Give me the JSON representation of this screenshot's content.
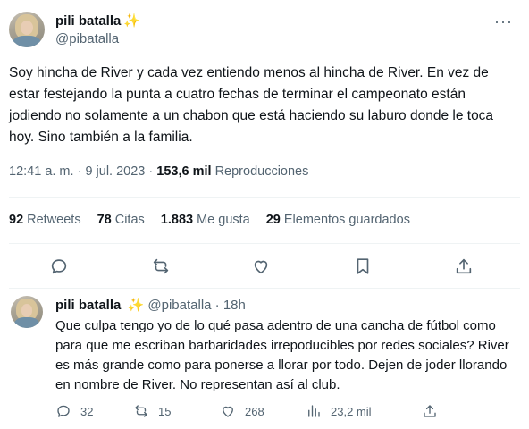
{
  "main_tweet": {
    "author_name": "pili batalla",
    "author_handle": "@pibatalla",
    "badge_emoji": "✨",
    "text": "Soy hincha de River y cada vez entiendo menos al hincha de River. En vez de estar festejando la punta a cuatro fechas de terminar el campeonato están jodiendo no solamente a un chabon que está haciendo su laburo donde le toca hoy. Sino también a la familia.",
    "time": "12:41 a. m.",
    "separator": "·",
    "date": "9 jul. 2023",
    "views_count": "153,6 mil",
    "views_label": "Reproducciones",
    "more_label": "···",
    "stats": {
      "retweets_count": "92",
      "retweets_label": "Retweets",
      "quotes_count": "78",
      "quotes_label": "Citas",
      "likes_count": "1.883",
      "likes_label": "Me gusta",
      "bookmarks_count": "29",
      "bookmarks_label": "Elementos guardados"
    },
    "action_icons": [
      "reply-icon",
      "retweet-icon",
      "like-icon",
      "bookmark-icon",
      "share-icon"
    ]
  },
  "reply_tweet": {
    "author_name": "pili batalla",
    "badge_emoji": "✨",
    "author_handle": "@pibatalla",
    "separator": "·",
    "time_ago": "18h",
    "text": "Que culpa tengo yo de lo qué pasa adentro de una cancha de fútbol como para que me escriban barbaridades irrepoducibles por redes sociales? River es más grande como para ponerse a llorar por todo. Dejen de joder llorando en nombre de River. No representan así al club.",
    "replies": "32",
    "retweets": "15",
    "likes": "268",
    "views": "23,2 mil"
  },
  "colors": {
    "text_primary": "#0f1419",
    "text_secondary": "#536471",
    "divider": "#eff3f4",
    "sparkle": "#f4c430"
  }
}
